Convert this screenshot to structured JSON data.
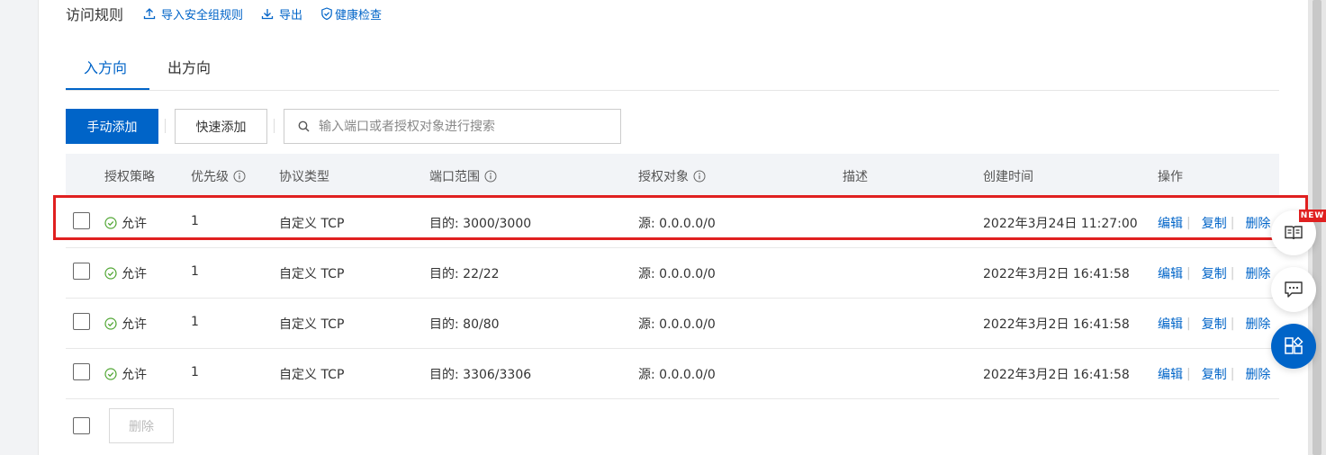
{
  "header": {
    "title": "访问规则",
    "links": [
      {
        "label": "导入安全组规则",
        "icon": "upload-icon"
      },
      {
        "label": "导出",
        "icon": "download-icon"
      },
      {
        "label": "健康检查",
        "icon": "shield-check-icon"
      }
    ]
  },
  "tabs": [
    {
      "label": "入方向",
      "active": true
    },
    {
      "label": "出方向",
      "active": false
    }
  ],
  "toolbar": {
    "manual_add": "手动添加",
    "quick_add": "快速添加",
    "search_placeholder": "输入端口或者授权对象进行搜索"
  },
  "table": {
    "columns": {
      "policy": "授权策略",
      "priority": "优先级",
      "protocol": "协议类型",
      "port": "端口范围",
      "target": "授权对象",
      "desc": "描述",
      "created": "创建时间",
      "actions": "操作"
    },
    "rows": [
      {
        "policy": "允许",
        "priority": "1",
        "protocol": "自定义 TCP",
        "port": "目的: 3000/3000",
        "target": "源: 0.0.0.0/0",
        "desc": "",
        "created": "2022年3月24日 11:27:00",
        "highlighted": true
      },
      {
        "policy": "允许",
        "priority": "1",
        "protocol": "自定义 TCP",
        "port": "目的: 22/22",
        "target": "源: 0.0.0.0/0",
        "desc": "",
        "created": "2022年3月2日 16:41:58",
        "highlighted": false
      },
      {
        "policy": "允许",
        "priority": "1",
        "protocol": "自定义 TCP",
        "port": "目的: 80/80",
        "target": "源: 0.0.0.0/0",
        "desc": "",
        "created": "2022年3月2日 16:41:58",
        "highlighted": false
      },
      {
        "policy": "允许",
        "priority": "1",
        "protocol": "自定义 TCP",
        "port": "目的: 3306/3306",
        "target": "源: 0.0.0.0/0",
        "desc": "",
        "created": "2022年3月2日 16:41:58",
        "highlighted": false
      }
    ],
    "row_actions": {
      "edit": "编辑",
      "copy": "复制",
      "delete": "删除"
    }
  },
  "footer": {
    "delete_label": "删除"
  },
  "float_buttons": {
    "new_badge": "NEW",
    "items": [
      "book-icon",
      "chat-icon",
      "apps-icon"
    ]
  },
  "colors": {
    "primary": "#0064c8",
    "highlight": "#e02020",
    "allow_green": "#52a735"
  }
}
